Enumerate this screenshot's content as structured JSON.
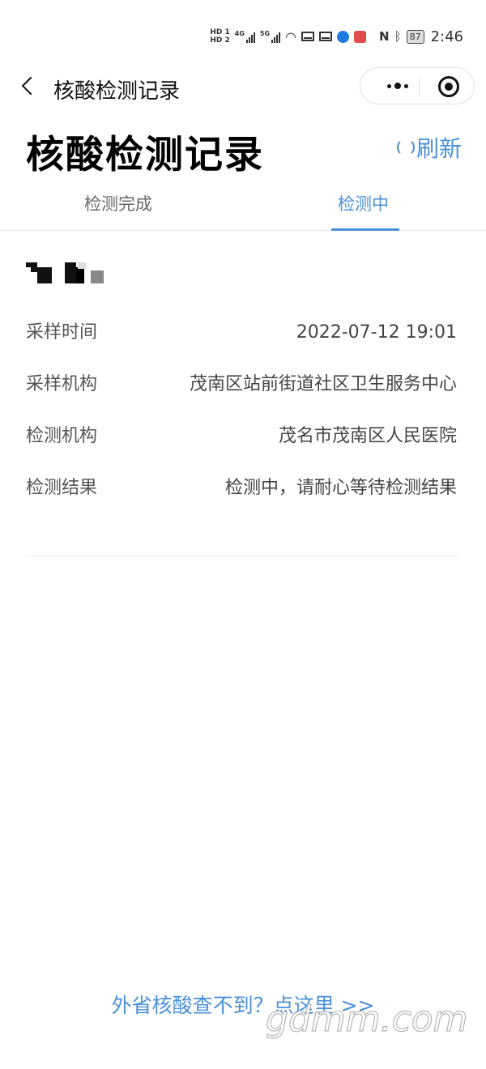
{
  "status_bar": {
    "sim1_label": "HD 1",
    "sim2_label": "HD 2",
    "net1": "4G",
    "net2": "5G",
    "battery": "87",
    "time": "2:46"
  },
  "nav": {
    "back_icon": "chevron-left-icon",
    "title": "核酸检测记录",
    "more_icon": "more-dots-icon",
    "close_icon": "target-close-icon"
  },
  "header": {
    "title": "核酸检测记录",
    "refresh_label": "刷新",
    "refresh_icon": "refresh-icon",
    "accent_color": "#4a90d9"
  },
  "tabs": [
    {
      "label": "检测完成",
      "active": false
    },
    {
      "label": "检测中",
      "active": true
    }
  ],
  "record": {
    "rows": [
      {
        "label": "采样时间",
        "value": "2022-07-12 19:01"
      },
      {
        "label": "采样机构",
        "value": "茂南区站前街道社区卫生服务中心"
      },
      {
        "label": "检测机构",
        "value": "茂名市茂南区人民医院"
      },
      {
        "label": "检测结果",
        "value": "检测中，请耐心等待检测结果"
      }
    ]
  },
  "footer": {
    "link_text": "外省核酸查不到？点这里 >>",
    "watermark": "gdmm.com"
  }
}
